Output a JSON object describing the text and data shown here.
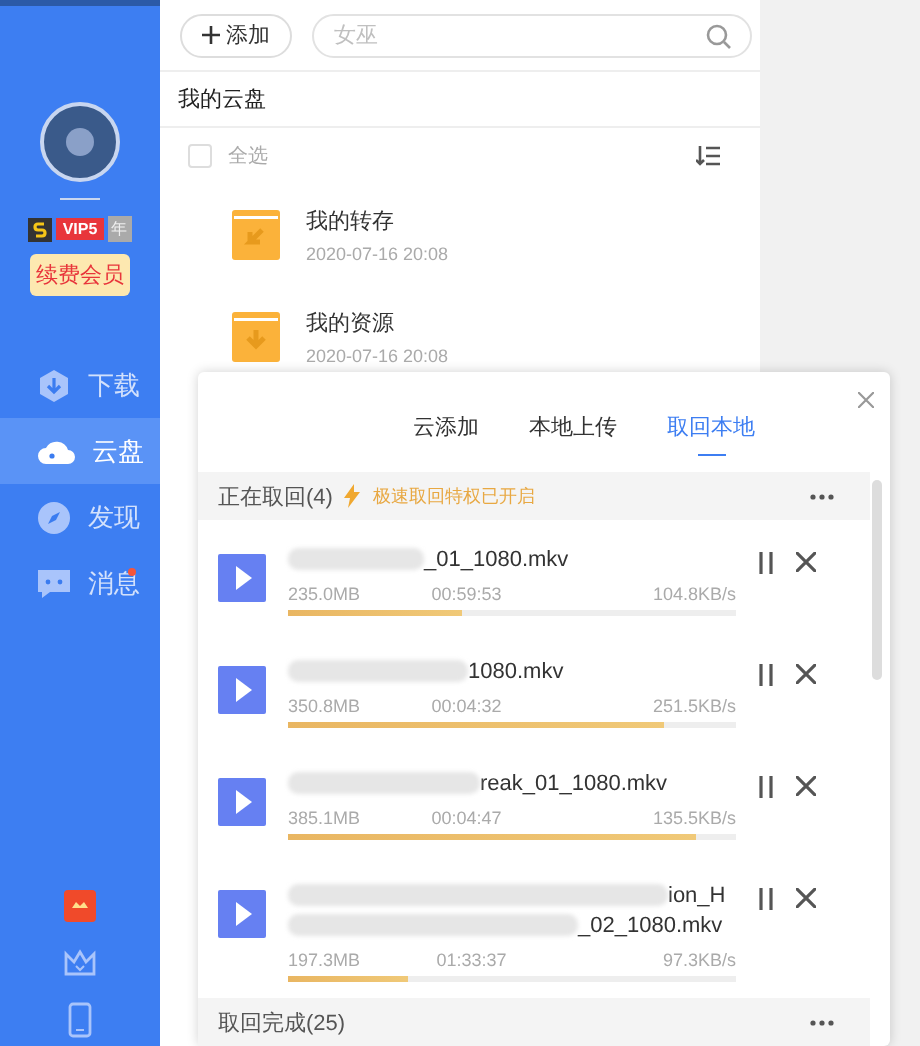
{
  "sidebar": {
    "vip_level": "VIP5",
    "vip_term": "年",
    "renew_button": "续费会员",
    "nav": [
      {
        "label": "下载",
        "kind": "download",
        "selected": false,
        "dot": false
      },
      {
        "label": "云盘",
        "kind": "cloud",
        "selected": true,
        "dot": false
      },
      {
        "label": "发现",
        "kind": "discover",
        "selected": false,
        "dot": false
      },
      {
        "label": "消息",
        "kind": "message",
        "selected": false,
        "dot": true
      }
    ]
  },
  "toolbar": {
    "add_button": "添加",
    "search": {
      "placeholder": "女巫"
    }
  },
  "cloud": {
    "title": "我的云盘",
    "select_all": "全选",
    "select_all_checked": false,
    "folders": [
      {
        "name": "我的转存",
        "date": "2020-07-16 20:08",
        "kind": "transfer"
      },
      {
        "name": "我的资源",
        "date": "2020-07-16 20:08",
        "kind": "download"
      }
    ]
  },
  "panel": {
    "tabs": [
      {
        "label": "云添加",
        "selected": false
      },
      {
        "label": "本地上传",
        "selected": false
      },
      {
        "label": "取回本地",
        "selected": true
      }
    ],
    "active_header": {
      "label": "正在取回(4)",
      "notice": "极速取回特权已开启"
    },
    "tasks": [
      {
        "name_lines": [
          "_01_1080.mkv"
        ],
        "size": "235.0MB",
        "time": "00:59:53",
        "speed": "104.8KB/s",
        "level": 0.39
      },
      {
        "name_lines": [
          "1080.mkv"
        ],
        "size": "350.8MB",
        "time": "00:04:32",
        "speed": "251.5KB/s",
        "level": 0.84
      },
      {
        "name_lines": [
          "reak_01_1080.mkv"
        ],
        "size": "385.1MB",
        "time": "00:04:47",
        "speed": "135.5KB/s",
        "level": 0.91
      },
      {
        "name_lines": [
          "ion_H",
          "_02_1080.mkv"
        ],
        "size": "197.3MB",
        "time": "01:33:37",
        "speed": "97.3KB/s",
        "level": 0.27
      }
    ],
    "done_header": "取回完成(25)"
  }
}
